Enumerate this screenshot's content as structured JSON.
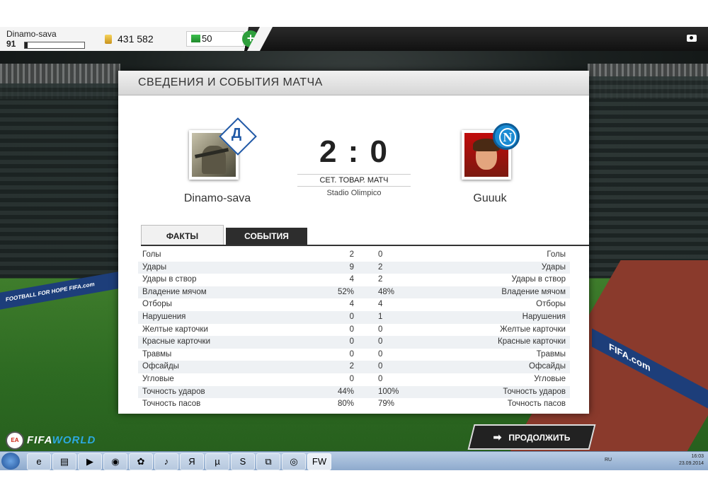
{
  "topbar": {
    "player_name": "Dinamo-sava",
    "player_level": "91",
    "xp_progress": 0.05,
    "coins": "431 582",
    "points": "50",
    "add_label": "+"
  },
  "panel": {
    "title": "СВЕДЕНИЯ И СОБЫТИЯ МАТЧА",
    "home_name": "Dinamo-sava",
    "away_name": "Guuuk",
    "score": "2 : 0",
    "match_type": "СЕТ. ТОВАР. МАТЧ",
    "stadium": "Stadio Olimpico",
    "tab_facts": "ФАКТЫ",
    "tab_events": "СОБЫТИЯ"
  },
  "stats": [
    {
      "label": "Голы",
      "home": "2",
      "away": "0"
    },
    {
      "label": "Удары",
      "home": "9",
      "away": "2"
    },
    {
      "label": "Удары в створ",
      "home": "4",
      "away": "2"
    },
    {
      "label": "Владение мячом",
      "home": "52%",
      "away": "48%"
    },
    {
      "label": "Отборы",
      "home": "4",
      "away": "4"
    },
    {
      "label": "Нарушения",
      "home": "0",
      "away": "1"
    },
    {
      "label": "Желтые карточки",
      "home": "0",
      "away": "0"
    },
    {
      "label": "Красные карточки",
      "home": "0",
      "away": "0"
    },
    {
      "label": "Травмы",
      "home": "0",
      "away": "0"
    },
    {
      "label": "Офсайды",
      "home": "2",
      "away": "0"
    },
    {
      "label": "Угловые",
      "home": "0",
      "away": "0"
    },
    {
      "label": "Точность ударов",
      "home": "44%",
      "away": "100%"
    },
    {
      "label": "Точность пасов",
      "home": "80%",
      "away": "79%"
    }
  ],
  "branding": {
    "ea": "EA SPORTS",
    "fifa": "FIFA",
    "world": "WORLD"
  },
  "continue_label": "ПРОДОЛЖИТЬ",
  "scene": {
    "board_left": "FOOTBALL FOR HOPE   FIFA.com",
    "board_right": "FIFA.com"
  },
  "taskbar": {
    "lang": "RU",
    "time": "16:03",
    "date": "23.09.2014",
    "icons": [
      "ie-icon",
      "explorer-icon",
      "media-icon",
      "chrome-icon",
      "clover-icon",
      "audio-icon",
      "yandex-icon",
      "utorrent-icon",
      "skype-icon",
      "network-icon",
      "origin-icon",
      "fifa-world-icon"
    ],
    "glyphs": [
      "e",
      "▤",
      "▶",
      "◉",
      "✿",
      "♪",
      "Я",
      "µ",
      "S",
      "⧉",
      "◎",
      "FW"
    ]
  }
}
